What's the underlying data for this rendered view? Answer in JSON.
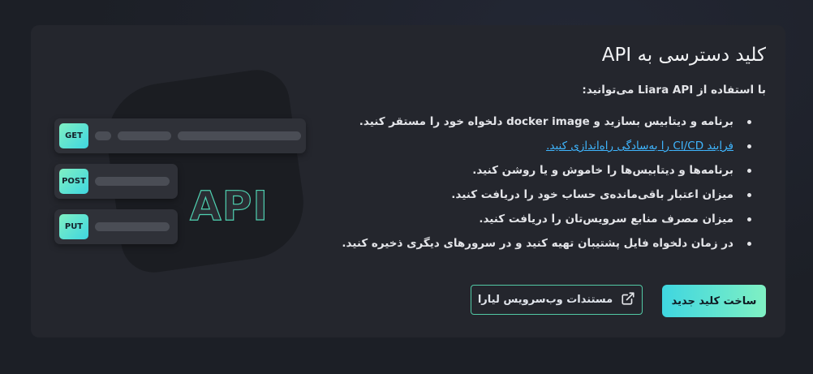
{
  "card": {
    "title": "کلید دسترسی به API",
    "intro": "با استفاده از Liara API می‌توانید:",
    "features": [
      "برنامه و دیتابیس بسازید و docker image دلخواه خود را مستقر کنید.",
      "فرایند CI/CD را به‌سادگی راه‌اندازی کنید.",
      "برنامه‌ها و دیتابیس‌ها را خاموش و یا روشن کنید.",
      "میزان اعتبار باقی‌مانده‌ی حساب خود را دریافت کنید.",
      "میزان مصرف منابع سرویس‌تان را دریافت کنید.",
      "در زمان دلخواه فایل پشتیبان تهیه کنید و در سرورهای دیگری ذخیره کنید."
    ],
    "create_key_label": "ساخت کلید جدید",
    "docs_label": "مستندات وب‌سرویس لیارا",
    "docs_icon": "external-link-icon"
  },
  "illustration": {
    "word": "API",
    "methods": [
      "GET",
      "POST",
      "PUT"
    ]
  },
  "colors": {
    "background": "#1c1f26",
    "card": "#24262d",
    "accent_start": "#7ff0c3",
    "accent_end": "#3fd6e0",
    "link": "#3fb6ff"
  }
}
